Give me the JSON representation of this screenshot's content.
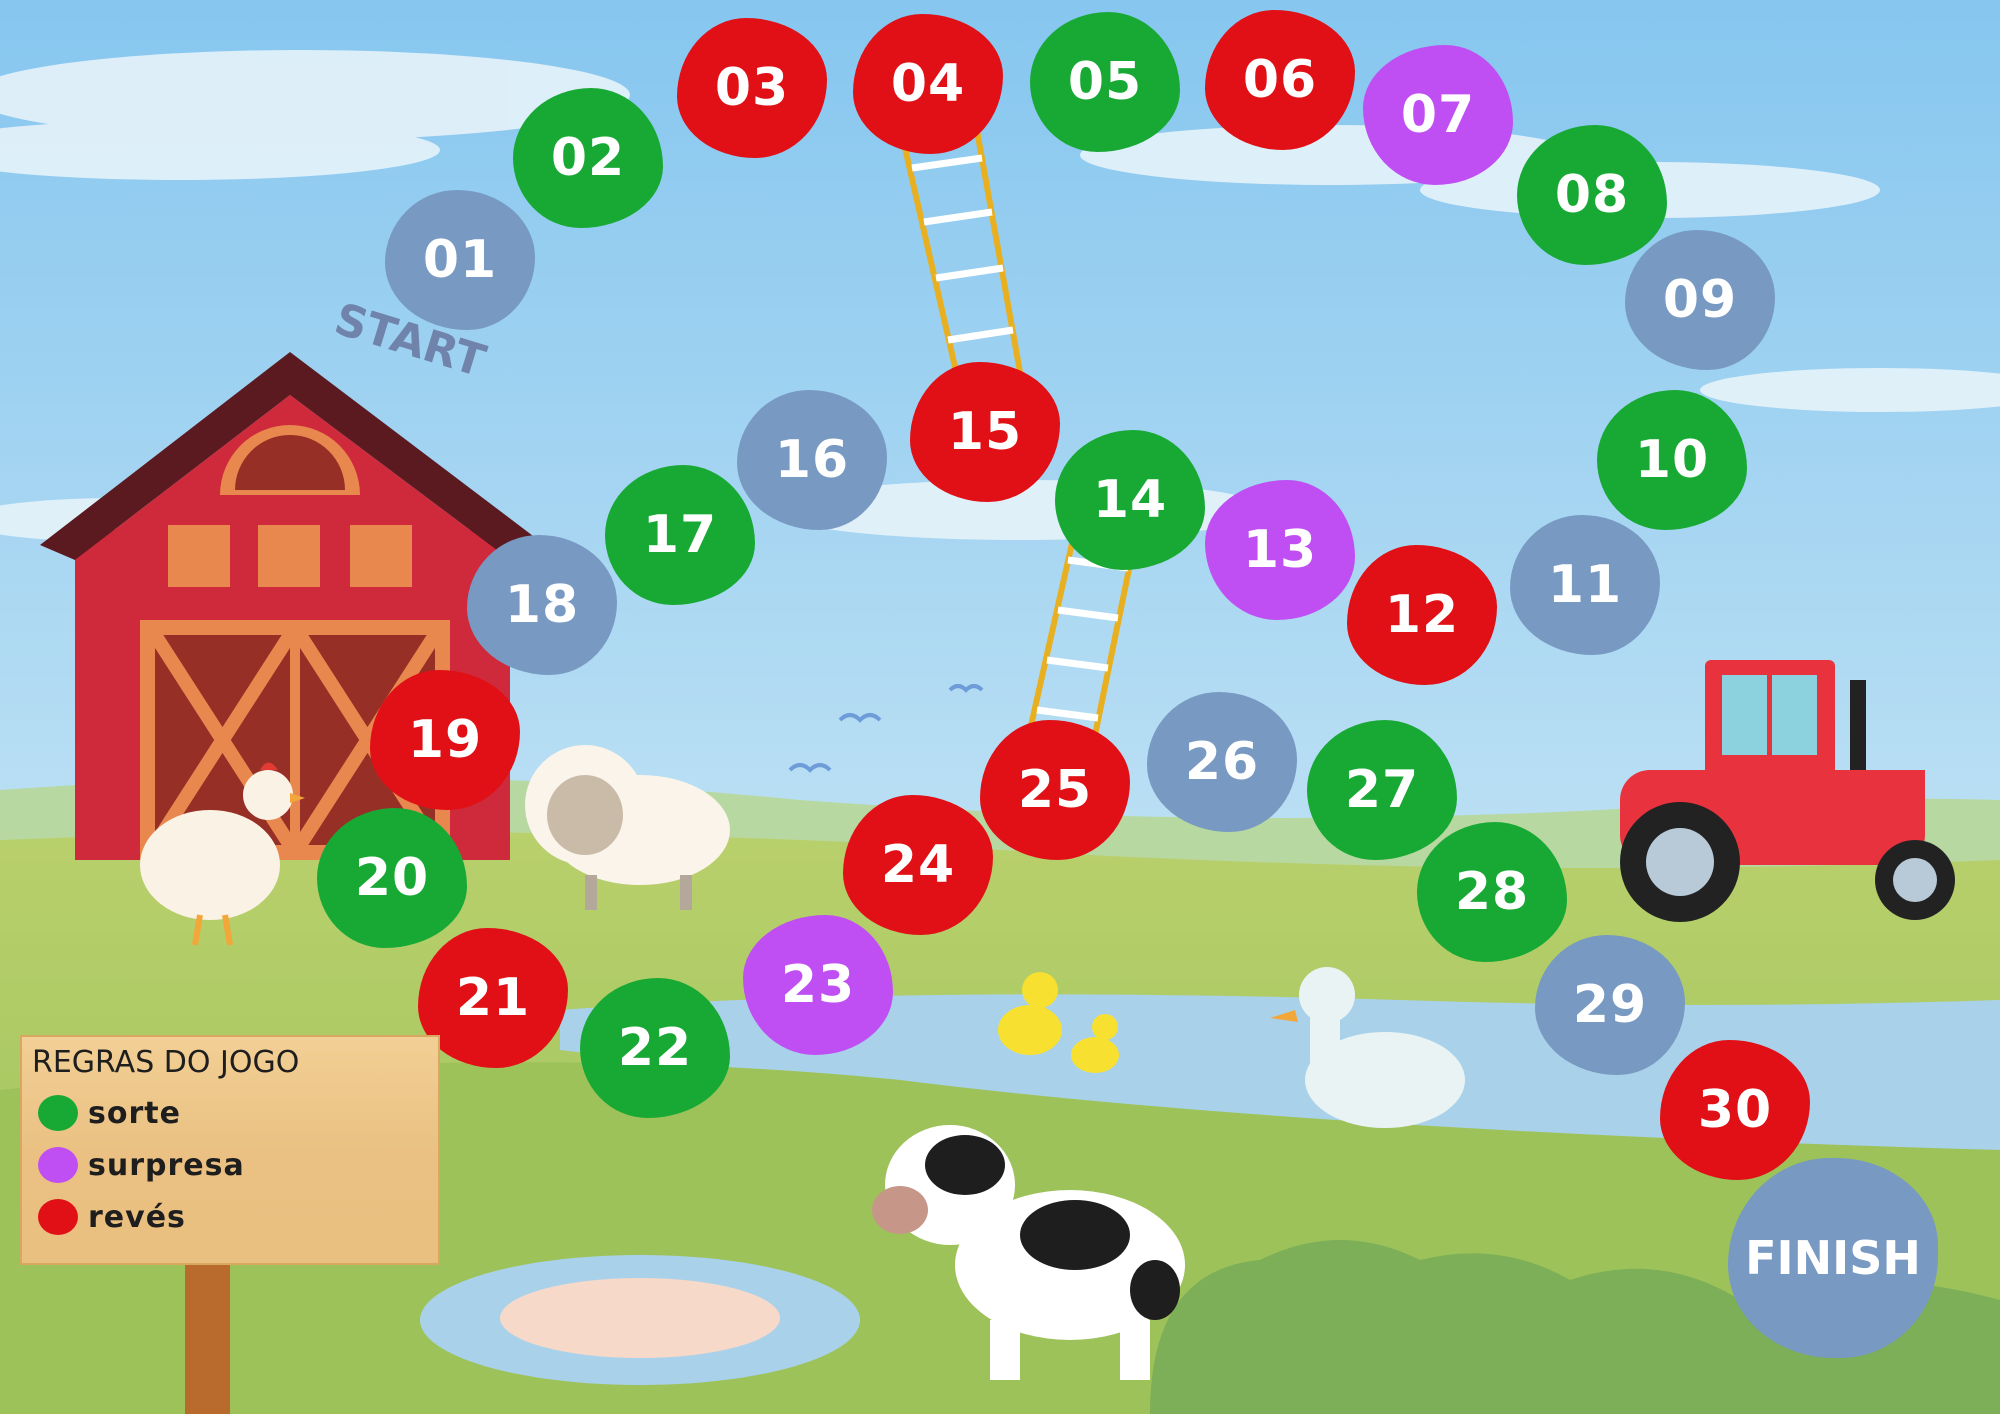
{
  "board": {
    "start_label": "START",
    "finish_label": "FINISH",
    "spaces": [
      {
        "label": "01",
        "color": "blue"
      },
      {
        "label": "02",
        "color": "green"
      },
      {
        "label": "03",
        "color": "red"
      },
      {
        "label": "04",
        "color": "red"
      },
      {
        "label": "05",
        "color": "green"
      },
      {
        "label": "06",
        "color": "red"
      },
      {
        "label": "07",
        "color": "purple"
      },
      {
        "label": "08",
        "color": "green"
      },
      {
        "label": "09",
        "color": "blue"
      },
      {
        "label": "10",
        "color": "green"
      },
      {
        "label": "11",
        "color": "blue"
      },
      {
        "label": "12",
        "color": "red"
      },
      {
        "label": "13",
        "color": "purple"
      },
      {
        "label": "14",
        "color": "green"
      },
      {
        "label": "15",
        "color": "red"
      },
      {
        "label": "16",
        "color": "blue"
      },
      {
        "label": "17",
        "color": "green"
      },
      {
        "label": "18",
        "color": "blue"
      },
      {
        "label": "19",
        "color": "red"
      },
      {
        "label": "20",
        "color": "green"
      },
      {
        "label": "21",
        "color": "red"
      },
      {
        "label": "22",
        "color": "green"
      },
      {
        "label": "23",
        "color": "purple"
      },
      {
        "label": "24",
        "color": "red"
      },
      {
        "label": "25",
        "color": "red"
      },
      {
        "label": "26",
        "color": "blue"
      },
      {
        "label": "27",
        "color": "green"
      },
      {
        "label": "28",
        "color": "green"
      },
      {
        "label": "29",
        "color": "blue"
      },
      {
        "label": "30",
        "color": "red"
      }
    ]
  },
  "rules": {
    "title": "REGRAS DO JOGO",
    "items": [
      {
        "label": "sorte",
        "color": "#18a935"
      },
      {
        "label": "surpresa",
        "color": "#bf4ff3"
      },
      {
        "label": "revés",
        "color": "#e01016"
      }
    ]
  },
  "colors": {
    "green": "#18a935",
    "red": "#e01016",
    "purple": "#bf4ff3",
    "blue": "#7799c2",
    "sky": "#9fd3ec",
    "grass": "#9dc25a"
  }
}
